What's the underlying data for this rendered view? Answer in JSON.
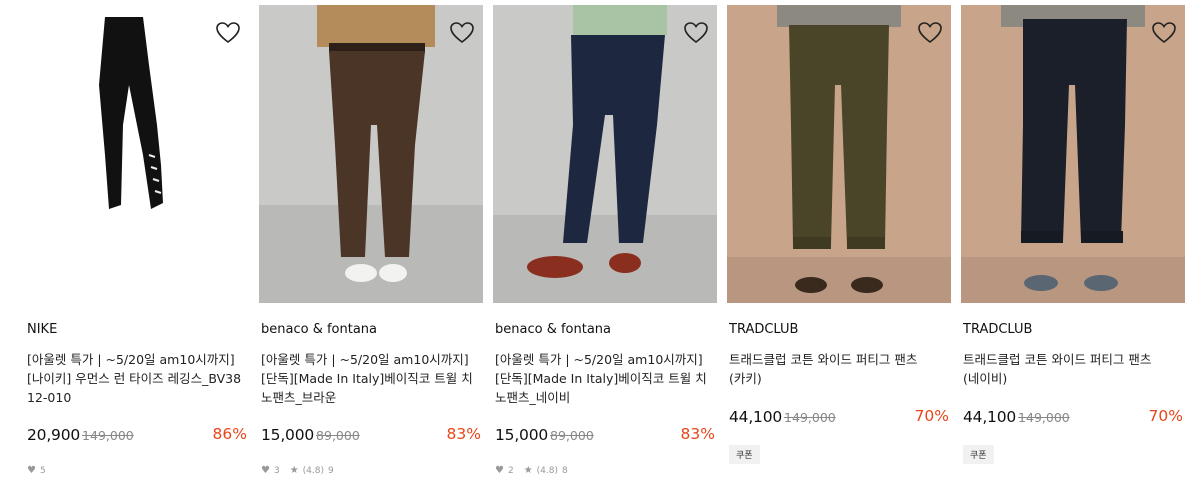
{
  "products": [
    {
      "brand": "NIKE",
      "title_line1": "[아울렛 특가 | ~5/20일 am10시까지]",
      "title_line2": "[나이키] 우먼스 런 타이즈 레깅스_BV3812-010",
      "price": "20,900",
      "original_price": "149,000",
      "discount": "86%",
      "likes": "5",
      "rating": "",
      "reviews": ""
    },
    {
      "brand": "benaco & fontana",
      "title_line1": "[아울렛 특가 | ~5/20일 am10시까지]",
      "title_line2": "[단독][Made In Italy]베이직코 트윌 치노팬츠_브라운",
      "price": "15,000",
      "original_price": "89,000",
      "discount": "83%",
      "likes": "3",
      "rating": "(4.8)",
      "reviews": "9"
    },
    {
      "brand": "benaco & fontana",
      "title_line1": "[아울렛 특가 | ~5/20일 am10시까지]",
      "title_line2": "[단독][Made In Italy]베이직코 트윌 치노팬츠_네이비",
      "price": "15,000",
      "original_price": "89,000",
      "discount": "83%",
      "likes": "2",
      "rating": "(4.8)",
      "reviews": "8"
    },
    {
      "brand": "TRADCLUB",
      "title_line1": "트래드클럽 코튼 와이드 퍼티그 팬츠",
      "title_line2": "(카키)",
      "price": "44,100",
      "original_price": "149,000",
      "discount": "70%",
      "coupon": "쿠폰"
    },
    {
      "brand": "TRADCLUB",
      "title_line1": "트래드클럽 코튼 와이드 퍼티그 팬츠",
      "title_line2": "(네이비)",
      "price": "44,100",
      "original_price": "149,000",
      "discount": "70%",
      "coupon": "쿠폰"
    }
  ],
  "colors": {
    "discount": "#e8461a",
    "pants_brown": "#4a3526",
    "pants_navy": "#1e2740",
    "pants_khaki": "#4a4528",
    "pants_darknavy": "#1b1f2a"
  },
  "icons": {
    "wishlist": "heart-outline-icon",
    "like": "heart-icon",
    "rating": "star-icon"
  }
}
